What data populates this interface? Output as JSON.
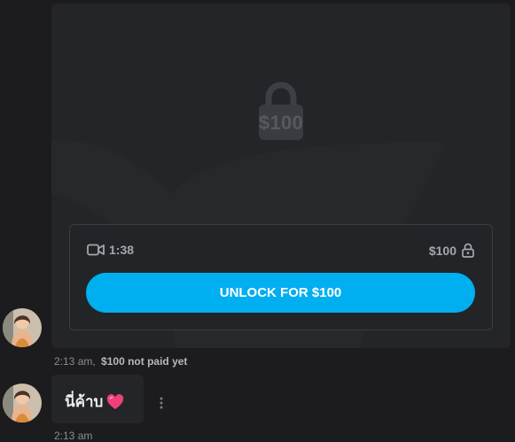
{
  "locked_post": {
    "preview_price": "$100",
    "media_duration": "1:38",
    "price": "$100",
    "unlock_label": "UNLOCK FOR $100",
    "icons": {
      "media": "video-camera-icon",
      "price": "lock-icon",
      "preview": "lock-icon"
    }
  },
  "messages": [
    {
      "time": "2:13 am,",
      "status": "$100 not paid yet"
    },
    {
      "text": "นี่ค้าบ",
      "emoji": "heart-icon",
      "time": "2:13 am"
    }
  ],
  "colors": {
    "accent": "#00aff0",
    "card_bg": "#242528",
    "page_bg": "#1c1c1f",
    "heart": "#f0407a"
  }
}
